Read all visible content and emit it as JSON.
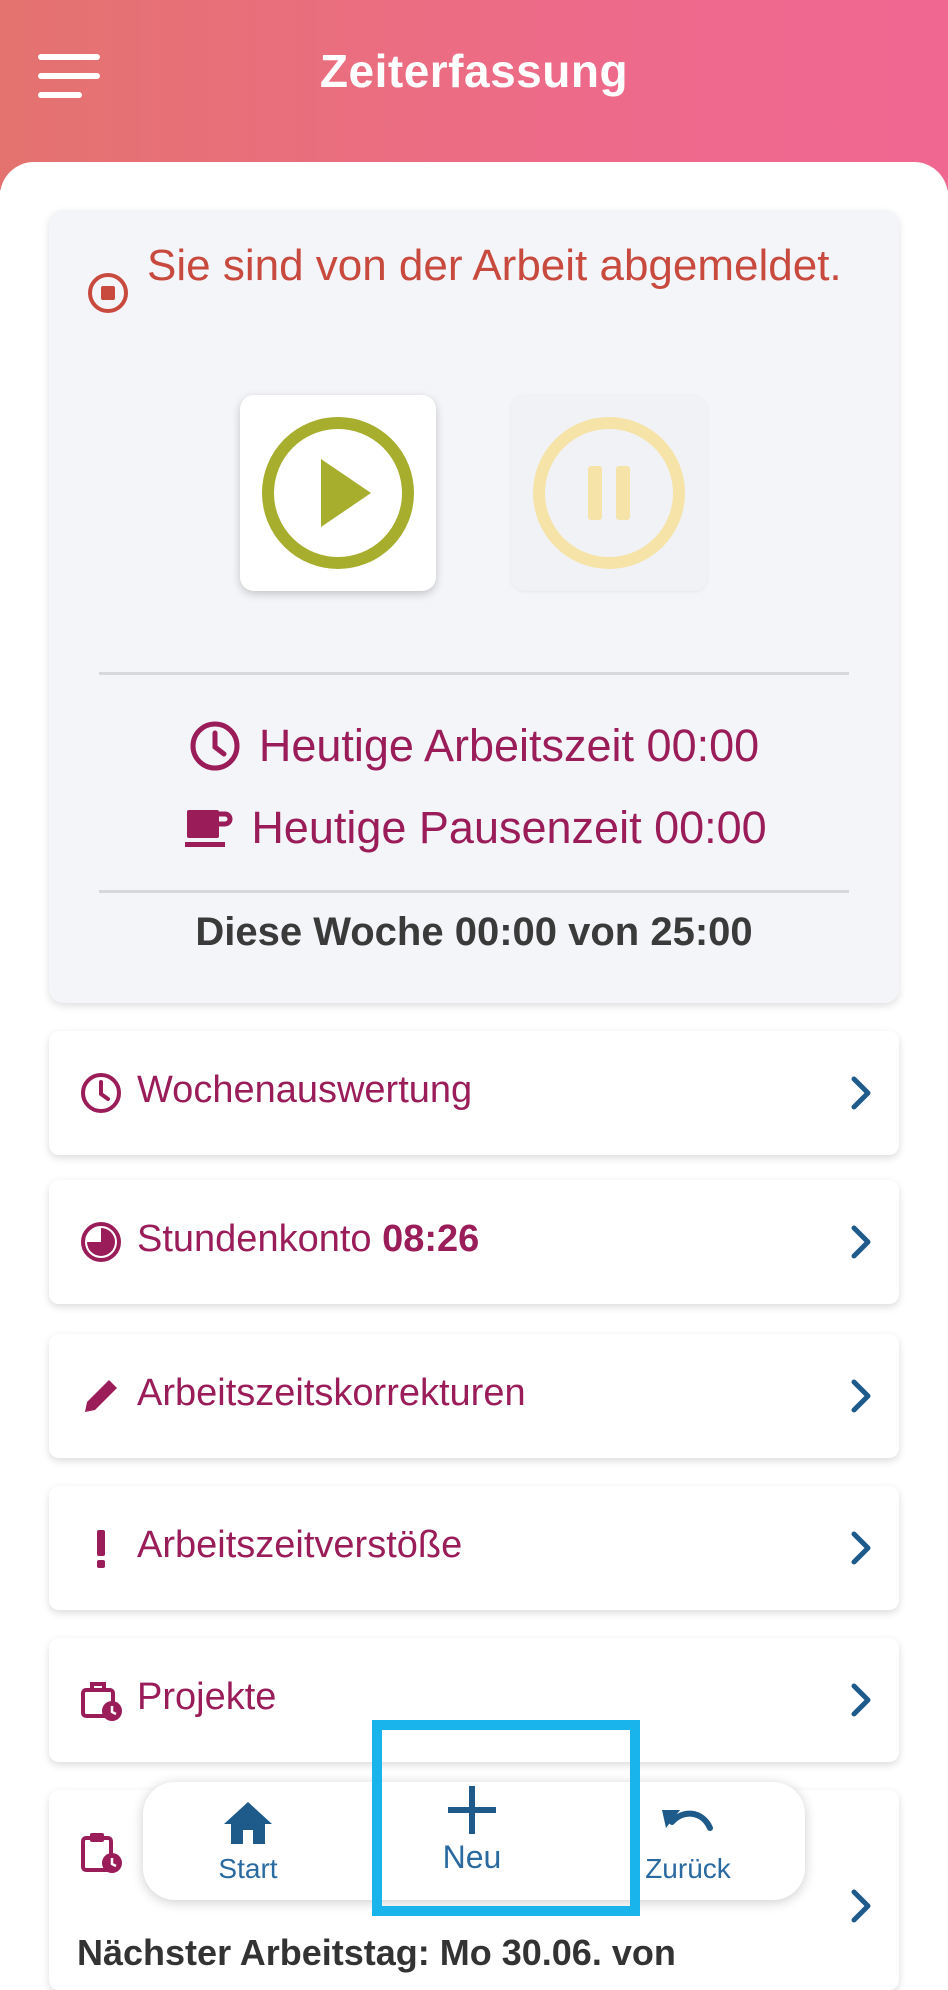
{
  "header": {
    "title": "Zeiterfassung"
  },
  "status": {
    "message": "Sie sind von der Arbeit abgemeldet."
  },
  "times": {
    "work_label": "Heutige Arbeitszeit 00:00",
    "break_label": "Heutige Pausenzeit 00:00",
    "week_summary": "Diese Woche 00:00 von 25:00"
  },
  "menu": {
    "weekly": "Wochenauswertung",
    "hours_label": "Stundenkonto",
    "hours_value": "08:26",
    "corrections": "Arbeitszeitskorrekturen",
    "violations": "Arbeitszeitverstöße",
    "projects": "Projekte",
    "next_day": "Nächster Arbeitstag: Mo 30.06. von"
  },
  "nav": {
    "start": "Start",
    "new": "Neu",
    "back": "Zurück"
  },
  "colors": {
    "accent": "#9a1d5a",
    "status_red": "#c8493d",
    "play_green": "#a7ad2c",
    "pause_yellow": "#f6e3a8",
    "nav_blue": "#1e5a8a",
    "highlight": "#19b4ec"
  }
}
